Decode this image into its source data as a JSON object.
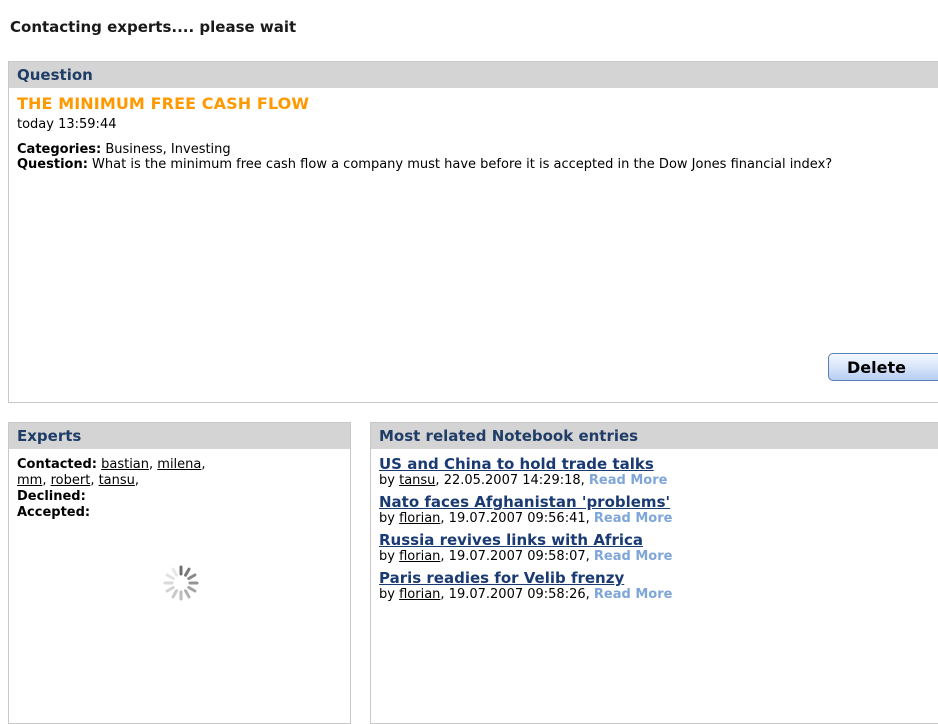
{
  "status_text": "Contacting experts.... please wait",
  "question": {
    "header": "Question",
    "title": "THE MINIMUM FREE CASH FLOW",
    "time": "today 13:59:44",
    "categories_label": "Categories:",
    "categories": " Business, Investing",
    "question_label": "Question:",
    "question_text": " What is the minimum free cash flow a company must have before it is accepted in the Dow Jones financial index?",
    "delete_label": "Delete"
  },
  "experts": {
    "header": "Experts",
    "contacted_label": "Contacted:",
    "contacted": [
      "bastian",
      "milena",
      "mm",
      "robert",
      "tansu"
    ],
    "declined_label": "Declined:",
    "accepted_label": "Accepted:"
  },
  "entries": {
    "header": "Most related Notebook entries",
    "by_label": "by",
    "read_more": "Read More",
    "items": [
      {
        "title": "US and China to hold trade talks",
        "author": "tansu",
        "date": "22.05.2007 14:29:18"
      },
      {
        "title": "Nato faces Afghanistan 'problems'",
        "author": "florian",
        "date": "19.07.2007 09:56:41"
      },
      {
        "title": "Russia revives links with Africa",
        "author": "florian",
        "date": "19.07.2007 09:58:07"
      },
      {
        "title": "Paris readies for Velib frenzy",
        "author": "florian",
        "date": "19.07.2007 09:58:26"
      }
    ]
  },
  "icons": {
    "loading": "loading-spinner-icon"
  },
  "colors": {
    "title_orange": "#ff9900",
    "link_blue": "#1a3a73",
    "header_bg": "#d4d4d4",
    "read_more": "#7fa6d8"
  }
}
